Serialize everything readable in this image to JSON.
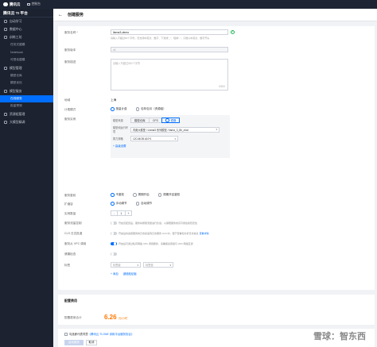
{
  "topbar": {
    "brand": "腾讯云",
    "console": "控制台"
  },
  "sidebar": {
    "title": "腾讯云 TI 平台",
    "items": [
      {
        "label": "自动学习",
        "type": "item"
      },
      {
        "label": "数据中心",
        "type": "item"
      },
      {
        "label": "训练工坊",
        "type": "item"
      },
      {
        "label": "任务式建模",
        "type": "sub"
      },
      {
        "label": "Notebook",
        "type": "sub"
      },
      {
        "label": "可视化建模",
        "type": "sub"
      },
      {
        "label": "模型管理",
        "type": "item"
      },
      {
        "label": "模型仓库",
        "type": "sub"
      },
      {
        "label": "模型优化",
        "type": "sub"
      },
      {
        "label": "模型服务",
        "type": "item"
      },
      {
        "label": "在线服务",
        "type": "sub",
        "active": true
      },
      {
        "label": "批量预测",
        "type": "sub"
      },
      {
        "label": "资源组管理",
        "type": "item"
      },
      {
        "label": "大模型精调",
        "type": "item"
      }
    ]
  },
  "page": {
    "title": "创建服务",
    "back": "←"
  },
  "form": {
    "name_label": "服务名称 *",
    "name_value": "llama3-demo",
    "name_hint": "请输入不超过60个字符，仅支持中英文、数字、下划线\"_\"、短横\"-\"，只能以中英文、数字开头",
    "version_label": "服务版本",
    "version_value": "v1",
    "desc_label": "服务描述",
    "desc_placeholder": "请输入不超过500个字符",
    "desc_count": "0/500",
    "region_label": "地域",
    "region_value": "上海",
    "billing_label": "计费模式",
    "billing_options": [
      "按量计费",
      "包年包月（资源组）"
    ],
    "instance_label": "服务实例",
    "model_source_label": "模型来源",
    "model_source_tabs": [
      "模型仓库",
      "CFS",
      "镜像"
    ],
    "model_select_label": "模型和运行环境",
    "model_select_value": "内置大模型 / Llama3 系列模型 / llama_3_8b_chat",
    "spec_label": "算力规格",
    "spec_value": "12C44GB A10*1",
    "advanced": "+ 高级设置",
    "auth_label": "服务鉴权",
    "auth_options": [
      "不鉴权",
      "周期开启",
      "周期开启鉴权"
    ],
    "scale_label": "扩缩容",
    "scale_options": [
      "手动调节",
      "自动调节"
    ],
    "count_label": "实例数量",
    "count_minus": "-",
    "count_value": "1",
    "count_plus": "+",
    "flow_label": "服务流量控制",
    "flow_text": "开启该配置后，服务将按照流量进行负载，以保障服务的高可用性和稳定性",
    "cls_label": "CLS 日志投递",
    "cls_text": "开启后将会把服务的日志投递到日志服务 CLS 中，便于查看和分析日志信息",
    "cls_link": "查看详情",
    "vpc_label": "服务从 VPC 调用",
    "vpc_text": "开启后可通过私有网络 VPC 调用服务，请确保资源组与 VPC 网络互通",
    "health_label": "健康检查",
    "tag_label": "标签",
    "tag_key": "标签键",
    "tag_val": "标签值",
    "tag_add": "+ 添加",
    "tag_keyval": "键值粘贴板"
  },
  "pricing": {
    "title": "配置费用",
    "fee_label": "配置费用合计",
    "price": "6.26",
    "unit": "元/小时"
  },
  "footer": {
    "agree": "勾选即代表同意",
    "agree_link": "《腾讯云 TI-ONE 训练平台服务协议》",
    "submit": "启动服务",
    "cancel": "取消"
  },
  "watermark": "雪球：智东西",
  "colors": {
    "accent": "#006eff",
    "price": "#ff7800",
    "sidebar": "#1c2230"
  }
}
